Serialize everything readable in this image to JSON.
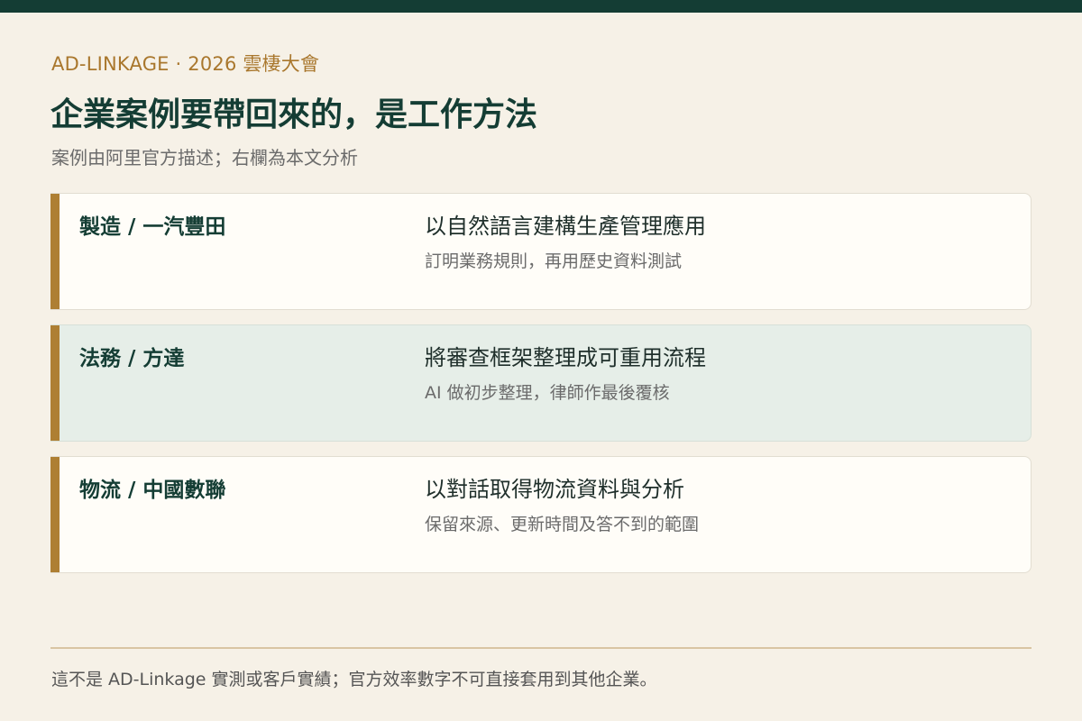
{
  "header": {
    "eyebrow": "AD-LINKAGE · 2026 雲棲大會",
    "title": "企業案例要帶回來的，是工作方法",
    "subtitle": "案例由阿里官方描述；右欄為本文分析"
  },
  "cases": [
    {
      "title": "製造 / 一汽豐田",
      "description": "以自然語言建構生產管理應用",
      "note": "訂明業務規則，再用歷史資料測試"
    },
    {
      "title": "法務 / 方達",
      "description": "將審查框架整理成可重用流程",
      "note": "AI 做初步整理，律師作最後覆核"
    },
    {
      "title": "物流 / 中國數聯",
      "description": "以對話取得物流資料與分析",
      "note": "保留來源、更新時間及答不到的範圍"
    }
  ],
  "footer": {
    "disclaimer": "這不是 AD-Linkage 實測或客戶實績；官方效率數字不可直接套用到其他企業。"
  },
  "colors": {
    "background": "#f6f1e7",
    "top_bar": "#143d34",
    "accent": "#ae7f33",
    "title": "#143d34",
    "highlight_card": "#e6eee8"
  }
}
